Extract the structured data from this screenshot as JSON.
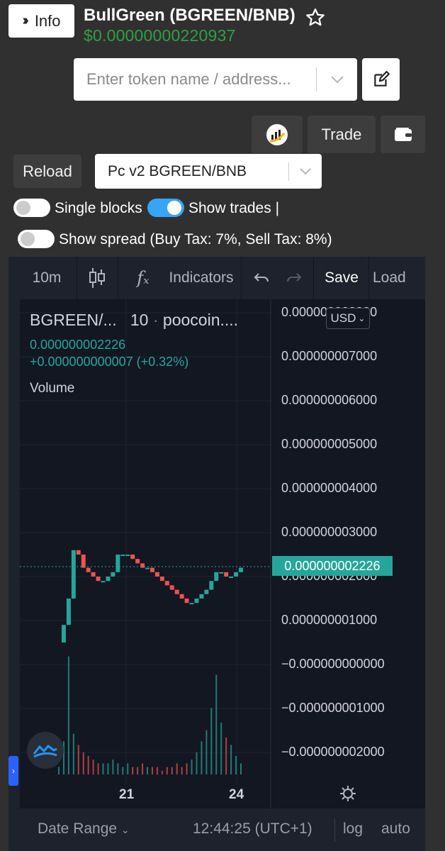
{
  "header": {
    "info_label": "Info",
    "title": "BullGreen (BGREEN/BNB)",
    "price": "$0.00000000220937"
  },
  "search": {
    "placeholder": "Enter token name / address..."
  },
  "toolbar": {
    "trade_label": "Trade",
    "reload_label": "Reload"
  },
  "pair_select": {
    "value": "Pc v2 BGREEN/BNB"
  },
  "toggles": {
    "single_blocks": {
      "label": "Single blocks",
      "on": false
    },
    "show_trades": {
      "label": "Show trades |",
      "on": true
    },
    "show_spread": {
      "label": "Show spread (Buy Tax: 7%, Sell Tax: 8%)",
      "on": false
    }
  },
  "chart": {
    "toolbar": {
      "interval": "10m",
      "indicators": "Indicators",
      "save": "Save",
      "load": "Load"
    },
    "legend": {
      "symbol": "BGREEN/...",
      "interval": "10",
      "source": "poocoin....",
      "price": "0.000000002226",
      "change": "+0.000000000007 (+0.32%)",
      "volume_label": "Volume"
    },
    "currency": "USD",
    "price_tag": "0.000000002226",
    "bottom": {
      "date_range": "Date Range",
      "time": "12:44:25 (UTC+1)",
      "log": "log",
      "auto": "auto"
    },
    "colors": {
      "up": "#26a69a",
      "down": "#ef5350",
      "accent": "#2ea043"
    }
  },
  "chart_data": {
    "type": "line",
    "title": "BGREEN/... 10 poocoin....",
    "x_ticks": [
      "21",
      "24"
    ],
    "y_ticks": [
      "0.000000008000",
      "0.000000007000",
      "0.000000006000",
      "0.000000005000",
      "0.000000004000",
      "0.000000003000",
      "0.000000002000",
      "0.000000001000",
      "−0.000000000000",
      "−0.000000001000",
      "−0.000000002000"
    ],
    "ylim": [
      -2.3e-09,
      8.3e-09
    ],
    "last_price": 2.226e-09,
    "price_series": [
      5e-10,
      9e-10,
      1.5e-09,
      2.6e-09,
      2.5e-09,
      2.2e-09,
      2.1e-09,
      2e-09,
      1.9e-09,
      1.9e-09,
      2e-09,
      2.1e-09,
      2.5e-09,
      2.5e-09,
      2.5e-09,
      2.4e-09,
      2.3e-09,
      2.2e-09,
      2.2e-09,
      2.1e-09,
      2e-09,
      1.9e-09,
      1.8e-09,
      1.7e-09,
      1.6e-09,
      1.5e-09,
      1.4e-09,
      1.4e-09,
      1.5e-09,
      1.6e-09,
      1.7e-09,
      1.9e-09,
      2.1e-09,
      2.1e-09,
      2e-09,
      2e-09,
      2.1e-09,
      2.2e-09
    ],
    "volume_series": [
      0.2,
      0.9,
      3.2,
      1.1,
      0.8,
      0.6,
      0.5,
      0.4,
      0.3,
      0.3,
      0.3,
      0.4,
      0.3,
      0.2,
      0.3,
      0.2,
      0.2,
      0.3,
      0.2,
      0.2,
      0.2,
      0.1,
      0.2,
      0.2,
      0.3,
      0.2,
      0.3,
      0.4,
      0.6,
      0.9,
      1.2,
      1.8,
      2.7,
      1.4,
      1.0,
      0.8,
      0.5,
      0.3
    ],
    "grid": true
  }
}
